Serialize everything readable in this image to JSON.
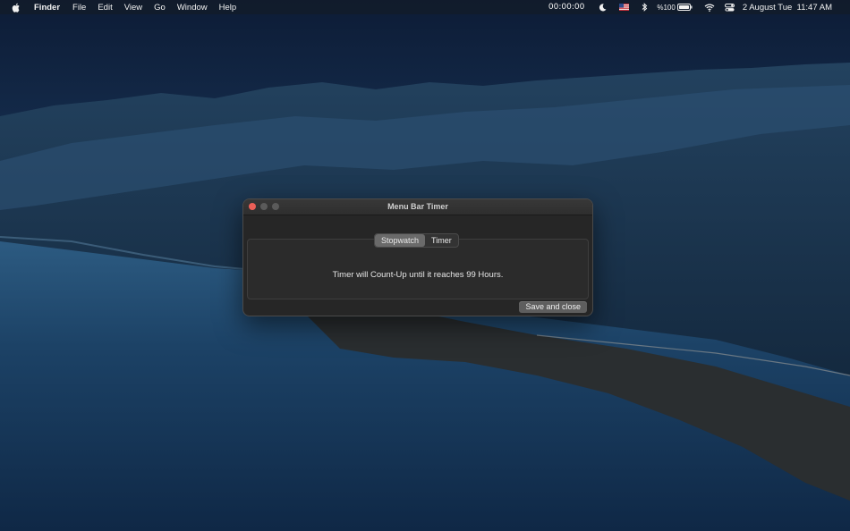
{
  "menubar": {
    "app_name": "Finder",
    "items": [
      "File",
      "Edit",
      "View",
      "Go",
      "Window",
      "Help"
    ],
    "status": {
      "timer": "00:00:00",
      "battery": "%100",
      "datetime": "2 August Tue  11:47 AM"
    }
  },
  "window": {
    "title": "Menu Bar Timer",
    "tabs": [
      {
        "label": "Stopwatch",
        "selected": true
      },
      {
        "label": "Timer",
        "selected": false
      }
    ],
    "message": "Timer will Count-Up until it reaches 99 Hours.",
    "save_label": "Save and close"
  },
  "colors": {
    "close_button": "#ec5f57",
    "window_bg": "#262626",
    "selected_tab": "#6a6a6a"
  }
}
